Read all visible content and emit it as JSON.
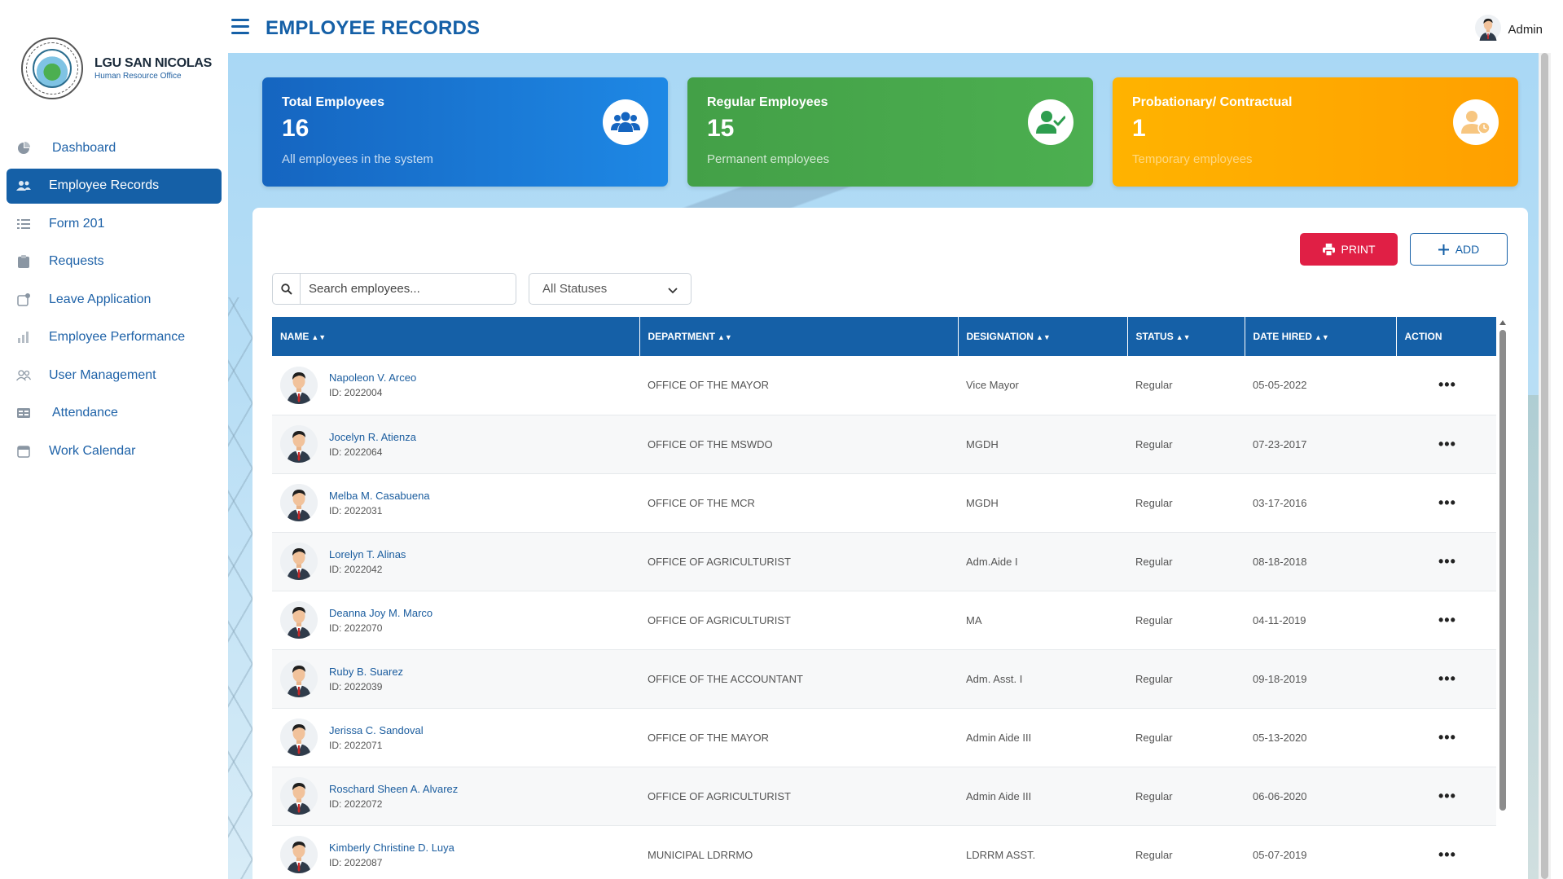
{
  "brand": {
    "title": "LGU SAN NICOLAS",
    "subtitle": "Human Resource Office"
  },
  "sidebar": {
    "items": [
      {
        "label": "Dashboard",
        "icon": "pie-chart-icon",
        "active": false
      },
      {
        "label": "Employee Records",
        "icon": "users-icon",
        "active": true
      },
      {
        "label": "Form 201",
        "icon": "list-icon",
        "active": false
      },
      {
        "label": "Requests",
        "icon": "clipboard-icon",
        "active": false
      },
      {
        "label": "Leave Application",
        "icon": "leave-icon",
        "active": false
      },
      {
        "label": "Employee Performance",
        "icon": "bar-chart-icon",
        "active": false
      },
      {
        "label": "User Management",
        "icon": "user-group-icon",
        "active": false
      },
      {
        "label": "Attendance",
        "icon": "table-icon",
        "active": false
      },
      {
        "label": "Work Calendar",
        "icon": "calendar-icon",
        "active": false
      }
    ]
  },
  "header": {
    "title": "EMPLOYEE RECORDS",
    "user_name": "Admin"
  },
  "cards": [
    {
      "title": "Total Employees",
      "value": "16",
      "sub": "All employees in the system",
      "color": "#1976d2",
      "icon": "users-icon"
    },
    {
      "title": "Regular Employees",
      "value": "15",
      "sub": "Permanent employees",
      "color": "#4caf50",
      "icon": "user-check-icon"
    },
    {
      "title": "Probationary/ Contractual",
      "value": "1",
      "sub": "Temporary employees",
      "color": "#ffaa00",
      "icon": "user-clock-icon"
    }
  ],
  "toolbar": {
    "print_label": "PRINT",
    "add_label": "ADD"
  },
  "search": {
    "placeholder": "Search employees...",
    "value": ""
  },
  "filter": {
    "selected": "All Statuses"
  },
  "table": {
    "columns": [
      "NAME",
      "DEPARTMENT",
      "DESIGNATION",
      "STATUS",
      "DATE HIRED",
      "ACTION"
    ],
    "rows": [
      {
        "name": "Napoleon V. Arceo",
        "id": "ID: 2022004",
        "department": "OFFICE OF THE MAYOR",
        "designation": "Vice Mayor",
        "status": "Regular",
        "date_hired": "05-05-2022"
      },
      {
        "name": "Jocelyn R. Atienza",
        "id": "ID: 2022064",
        "department": "OFFICE OF THE MSWDO",
        "designation": "MGDH",
        "status": "Regular",
        "date_hired": "07-23-2017"
      },
      {
        "name": "Melba M. Casabuena",
        "id": "ID: 2022031",
        "department": "OFFICE OF THE MCR",
        "designation": "MGDH",
        "status": "Regular",
        "date_hired": "03-17-2016"
      },
      {
        "name": "Lorelyn T. Alinas",
        "id": "ID: 2022042",
        "department": "OFFICE OF AGRICULTURIST",
        "designation": "Adm.Aide I",
        "status": "Regular",
        "date_hired": "08-18-2018"
      },
      {
        "name": "Deanna Joy M. Marco",
        "id": "ID: 2022070",
        "department": "OFFICE OF AGRICULTURIST",
        "designation": "MA",
        "status": "Regular",
        "date_hired": "04-11-2019"
      },
      {
        "name": "Ruby B. Suarez",
        "id": "ID: 2022039",
        "department": "OFFICE OF THE ACCOUNTANT",
        "designation": "Adm. Asst. I",
        "status": "Regular",
        "date_hired": "09-18-2019"
      },
      {
        "name": "Jerissa C. Sandoval",
        "id": "ID: 2022071",
        "department": "OFFICE OF THE MAYOR",
        "designation": "Admin Aide III",
        "status": "Regular",
        "date_hired": "05-13-2020"
      },
      {
        "name": "Roschard Sheen A. Alvarez",
        "id": "ID: 2022072",
        "department": "OFFICE OF AGRICULTURIST",
        "designation": "Admin Aide III",
        "status": "Regular",
        "date_hired": "06-06-2020"
      },
      {
        "name": "Kimberly Christine D. Luya",
        "id": "ID: 2022087",
        "department": "MUNICIPAL LDRRMO",
        "designation": "LDRRM ASST.",
        "status": "Regular",
        "date_hired": "05-07-2019"
      }
    ]
  },
  "colors": {
    "primary": "#1560a7",
    "print": "#e01f45"
  }
}
